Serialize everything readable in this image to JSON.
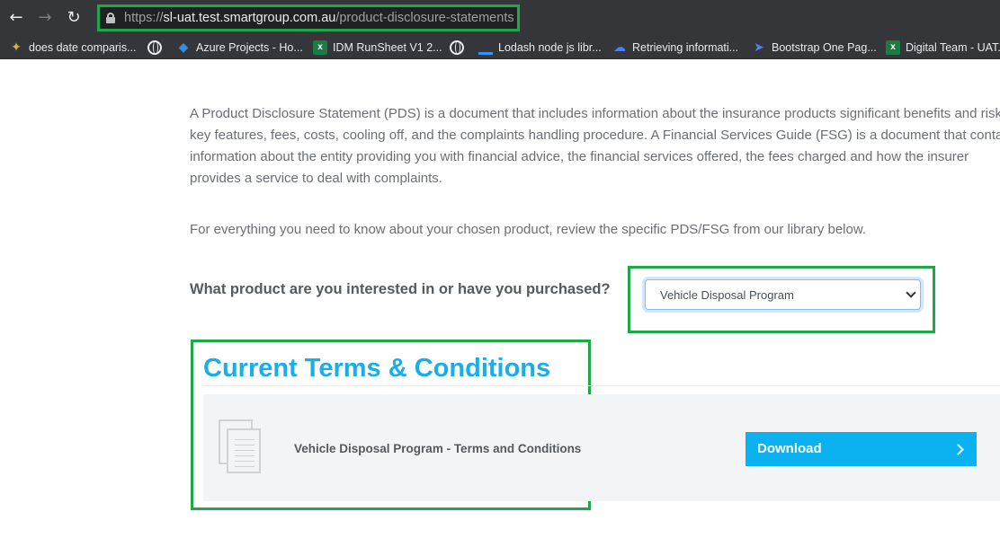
{
  "browser": {
    "back_icon": "arrow-left-icon",
    "forward_icon": "arrow-right-icon",
    "reload_icon": "reload-icon",
    "url_scheme": "https://",
    "url_host": "sl-uat.test.smartgroup.com.au",
    "url_path": "/product-disclosure-statements"
  },
  "bookmarks": [
    {
      "label": "does date comparis...",
      "icon": "spark-icon"
    },
    {
      "label": "",
      "icon": "globe-icon"
    },
    {
      "label": "Azure Projects - Ho...",
      "icon": "azure-devops-icon"
    },
    {
      "label": "IDM RunSheet V1 2...",
      "icon": "excel-icon"
    },
    {
      "label": "",
      "icon": "globe-icon"
    },
    {
      "label": "Lodash node js libr...",
      "icon": "lodash-icon"
    },
    {
      "label": "Retrieving informati...",
      "icon": "cloud-icon"
    },
    {
      "label": "Bootstrap One Pag...",
      "icon": "bootstrap-icon"
    },
    {
      "label": "Digital Team - UAT...",
      "icon": "excel-icon"
    }
  ],
  "page": {
    "intro_lines": [
      "A Product Disclosure Statement (PDS) is a document that includes information about the insurance products significant benefits and risks,",
      "key features, fees, costs, cooling off, and the complaints handling procedure. A Financial Services Guide (FSG) is a document that contains",
      "information about the entity providing you with financial advice, the financial services offered, the fees charged and how the insurer",
      "provides a service to deal with complaints."
    ],
    "library_text": "For everything you need to know about your chosen product, review the specific PDS/FSG from our library below.",
    "product_question": "What product are you interested in or have you purchased?",
    "product_select_value": "Vehicle Disposal Program",
    "terms_heading": "Current Terms & Conditions",
    "document_title": "Vehicle Disposal Program - Terms and Conditions",
    "download_label": "Download"
  },
  "colors": {
    "highlight_border": "#1ea84a",
    "heading_blue": "#1aaee8",
    "download_button": "#0cb2ef"
  }
}
